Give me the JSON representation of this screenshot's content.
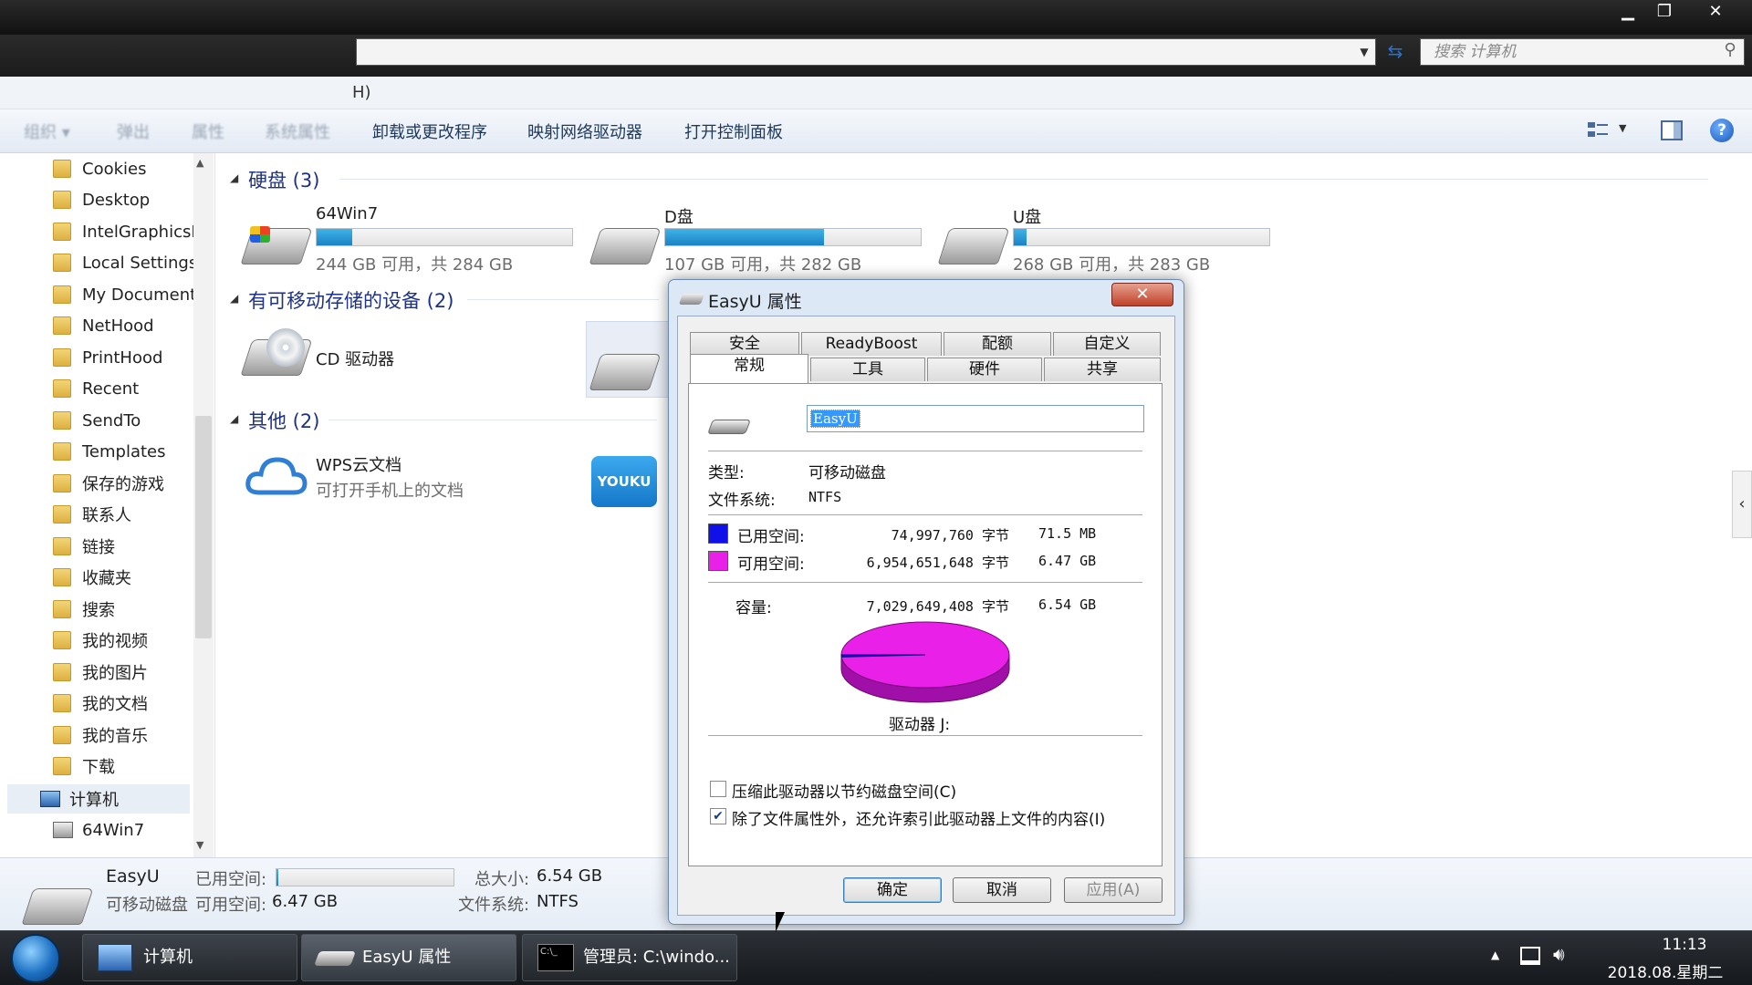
{
  "window": {
    "minimize": "▁",
    "maximize": "❐",
    "close": "✕"
  },
  "address": {
    "search_placeholder": "搜索 计算机"
  },
  "menu": {
    "fragment": "H)"
  },
  "toolbar": {
    "faded": [
      "组织 ▾",
      "弹出",
      "属性",
      "系统属性"
    ],
    "items": [
      "卸载或更改程序",
      "映射网络驱动器",
      "打开控制面板"
    ]
  },
  "nav": {
    "items": [
      "Cookies",
      "Desktop",
      "IntelGraphicsP",
      "Local Settings",
      "My Document",
      "NetHood",
      "PrintHood",
      "Recent",
      "SendTo",
      "Templates",
      "保存的游戏",
      "联系人",
      "链接",
      "收藏夹",
      "搜索",
      "我的视频",
      "我的图片",
      "我的文档",
      "我的音乐",
      "下载"
    ],
    "computer": "计算机",
    "drive": "64Win7"
  },
  "groups": {
    "hdd": "硬盘 (3)",
    "removable": "有可移动存储的设备 (2)",
    "other": "其他 (2)"
  },
  "drives": [
    {
      "name": "64Win7",
      "info": "244 GB 可用，共 284 GB",
      "used_fraction": 0.14
    },
    {
      "name": "D盘",
      "info": "107 GB 可用，共 282 GB",
      "used_fraction": 0.62
    },
    {
      "name": "U盘",
      "info": "268 GB 可用，共 283 GB",
      "used_fraction": 0.05
    }
  ],
  "removable": {
    "cd": "CD 驱动器"
  },
  "other": {
    "wps_name": "WPS云文档",
    "wps_sub": "可打开手机上的文档",
    "youku": "YOUKU"
  },
  "dialog": {
    "title": "EasyU 属性",
    "close": "✕",
    "tabs_top": [
      "安全",
      "ReadyBoost",
      "配额",
      "自定义"
    ],
    "tabs_bottom": [
      "常规",
      "工具",
      "硬件",
      "共享"
    ],
    "name": "EasyU",
    "type_label": "类型:",
    "type_value": "可移动磁盘",
    "fs_label": "文件系统:",
    "fs_value": "NTFS",
    "used_label": "已用空间:",
    "used_bytes": "74,997,760 字节",
    "used_size": "71.5 MB",
    "free_label": "可用空间:",
    "free_bytes": "6,954,651,648 字节",
    "free_size": "6.47 GB",
    "cap_label": "容量:",
    "cap_bytes": "7,029,649,408 字节",
    "cap_size": "6.54 GB",
    "drive_label": "驱动器 J:",
    "used_fraction": 0.0107,
    "used_color": "#1010e8",
    "free_color": "#e820e8",
    "compress": "压缩此驱动器以节约磁盘空间(C)",
    "index": "除了文件属性外，还允许索引此驱动器上文件的内容(I)",
    "compress_checked": false,
    "index_checked": true,
    "ok": "确定",
    "cancel": "取消",
    "apply": "应用(A)"
  },
  "details": {
    "name": "EasyU",
    "type": "可移动磁盘",
    "used_label": "已用空间:",
    "free_label": "可用空间:",
    "free_value": "6.47 GB",
    "total_label": "总大小:",
    "total_value": "6.54 GB",
    "fs_label": "文件系统:",
    "fs_value": "NTFS",
    "used_fraction": 0.0107
  },
  "taskbar": {
    "tasks": [
      "计算机",
      "EasyU 属性",
      "管理员: C:\\windo..."
    ],
    "time": "11:13",
    "date": "2018.08.星期二"
  }
}
